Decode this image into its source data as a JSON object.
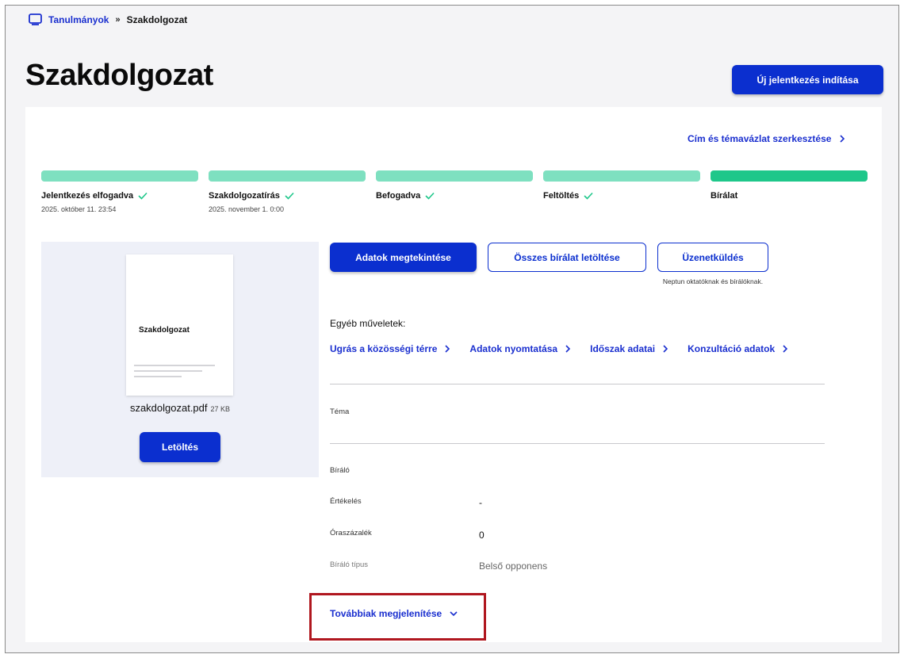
{
  "breadcrumb": {
    "parent": "Tanulmányok",
    "separator": "»",
    "current": "Szakdolgozat"
  },
  "page": {
    "title": "Szakdolgozat"
  },
  "header": {
    "new_application_button": "Új jelentkezés indítása"
  },
  "edit_link": "Cím és témavázlat szerkesztése",
  "steps": [
    {
      "label": "Jelentkezés elfogadva",
      "date": "2025. október 11. 23:54",
      "done": true
    },
    {
      "label": "Szakdolgozatírás",
      "date": "2025. november 1. 0:00",
      "done": true
    },
    {
      "label": "Befogadva",
      "date": "",
      "done": true
    },
    {
      "label": "Feltöltés",
      "date": "",
      "done": true
    },
    {
      "label": "Bírálat",
      "date": "",
      "done": false
    }
  ],
  "document": {
    "thumbnail_title": "Szakdolgozat",
    "filename": "szakdolgozat.pdf",
    "size": "27 KB",
    "download_button": "Letöltés"
  },
  "actions": {
    "view_button": "Adatok megtekintése",
    "all_reviews_button": "Összes bírálat letöltése",
    "message_button": "Üzenetküldés",
    "message_note": "Neptun oktatóknak és bírálóknak."
  },
  "other_ops": {
    "label": "Egyéb műveletek:",
    "links": [
      "Ugrás a közösségi térre",
      "Adatok nyomtatása",
      "Időszak adatai",
      "Konzultáció adatok"
    ]
  },
  "fields": {
    "topic_label": "Téma",
    "reviewer_label": "Bíráló",
    "grade_label": "Értékelés",
    "grade_value": "-",
    "hours_label": "Óraszázalék",
    "hours_value": "0",
    "reviewer_type_label": "Bíráló típus",
    "reviewer_type_value": "Belső opponens"
  },
  "more_link": "Továbbiak megjelenítése",
  "colors": {
    "accent": "#0b2fcf",
    "step_done": "#7ee0c0",
    "step_current": "#1ec78a",
    "highlight": "#b0171f"
  }
}
